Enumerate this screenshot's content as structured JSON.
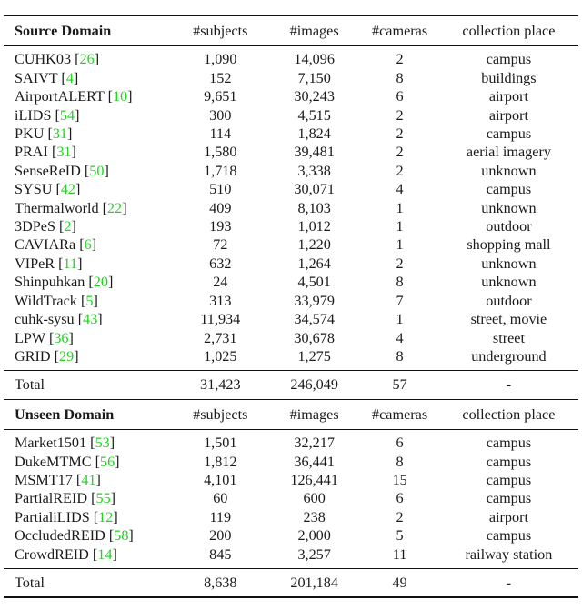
{
  "table": {
    "source_header": {
      "domain": "Source Domain",
      "subjects": "#subjects",
      "images": "#images",
      "cameras": "#cameras",
      "place": "collection place"
    },
    "source_rows": [
      {
        "name": "CUHK03",
        "ref": "26",
        "subjects": "1,090",
        "images": "14,096",
        "cameras": "2",
        "place": "campus"
      },
      {
        "name": "SAIVT",
        "ref": "4",
        "subjects": "152",
        "images": "7,150",
        "cameras": "8",
        "place": "buildings"
      },
      {
        "name": "AirportALERT",
        "ref": "10",
        "subjects": "9,651",
        "images": "30,243",
        "cameras": "6",
        "place": "airport"
      },
      {
        "name": "iLIDS",
        "ref": "54",
        "subjects": "300",
        "images": "4,515",
        "cameras": "2",
        "place": "airport"
      },
      {
        "name": "PKU",
        "ref": "31",
        "subjects": "114",
        "images": "1,824",
        "cameras": "2",
        "place": "campus"
      },
      {
        "name": "PRAI",
        "ref": "31",
        "subjects": "1,580",
        "images": "39,481",
        "cameras": "2",
        "place": "aerial imagery"
      },
      {
        "name": "SenseReID",
        "ref": "50",
        "subjects": "1,718",
        "images": "3,338",
        "cameras": "2",
        "place": "unknown"
      },
      {
        "name": "SYSU",
        "ref": "42",
        "subjects": "510",
        "images": "30,071",
        "cameras": "4",
        "place": "campus"
      },
      {
        "name": "Thermalworld",
        "ref": "22",
        "subjects": "409",
        "images": "8,103",
        "cameras": "1",
        "place": "unknown"
      },
      {
        "name": "3DPeS",
        "ref": "2",
        "subjects": "193",
        "images": "1,012",
        "cameras": "1",
        "place": "outdoor"
      },
      {
        "name": "CAVIARa",
        "ref": "6",
        "subjects": "72",
        "images": "1,220",
        "cameras": "1",
        "place": "shopping mall"
      },
      {
        "name": "VIPeR",
        "ref": "11",
        "subjects": "632",
        "images": "1,264",
        "cameras": "2",
        "place": "unknown"
      },
      {
        "name": "Shinpuhkan",
        "ref": "20",
        "subjects": "24",
        "images": "4,501",
        "cameras": "8",
        "place": "unknown"
      },
      {
        "name": "WildTrack",
        "ref": "5",
        "subjects": "313",
        "images": "33,979",
        "cameras": "7",
        "place": "outdoor"
      },
      {
        "name": "cuhk-sysu",
        "ref": "43",
        "subjects": "11,934",
        "images": "34,574",
        "cameras": "1",
        "place": "street, movie"
      },
      {
        "name": "LPW",
        "ref": "36",
        "subjects": "2,731",
        "images": "30,678",
        "cameras": "4",
        "place": "street"
      },
      {
        "name": "GRID",
        "ref": "29",
        "subjects": "1,025",
        "images": "1,275",
        "cameras": "8",
        "place": "underground"
      }
    ],
    "source_total": {
      "label": "Total",
      "subjects": "31,423",
      "images": "246,049",
      "cameras": "57",
      "place": "-"
    },
    "unseen_header": {
      "domain": "Unseen Domain",
      "subjects": "#subjects",
      "images": "#images",
      "cameras": "#cameras",
      "place": "collection place"
    },
    "unseen_rows": [
      {
        "name": "Market1501",
        "ref": "53",
        "subjects": "1,501",
        "images": "32,217",
        "cameras": "6",
        "place": "campus"
      },
      {
        "name": "DukeMTMC",
        "ref": "56",
        "subjects": "1,812",
        "images": "36,441",
        "cameras": "8",
        "place": "campus"
      },
      {
        "name": "MSMT17",
        "ref": "41",
        "subjects": "4,101",
        "images": "126,441",
        "cameras": "15",
        "place": "campus"
      },
      {
        "name": "PartialREID",
        "ref": "55",
        "subjects": "60",
        "images": "600",
        "cameras": "6",
        "place": "campus"
      },
      {
        "name": "PartialiLIDS",
        "ref": "12",
        "subjects": "119",
        "images": "238",
        "cameras": "2",
        "place": "airport"
      },
      {
        "name": "OccludedREID",
        "ref": "58",
        "subjects": "200",
        "images": "2,000",
        "cameras": "5",
        "place": "campus"
      },
      {
        "name": "CrowdREID",
        "ref": "14",
        "subjects": "845",
        "images": "3,257",
        "cameras": "11",
        "place": "railway station"
      }
    ],
    "unseen_total": {
      "label": "Total",
      "subjects": "8,638",
      "images": "201,184",
      "cameras": "49",
      "place": "-"
    },
    "colors": {
      "citation": "#22d322",
      "rule": "#111111"
    }
  }
}
